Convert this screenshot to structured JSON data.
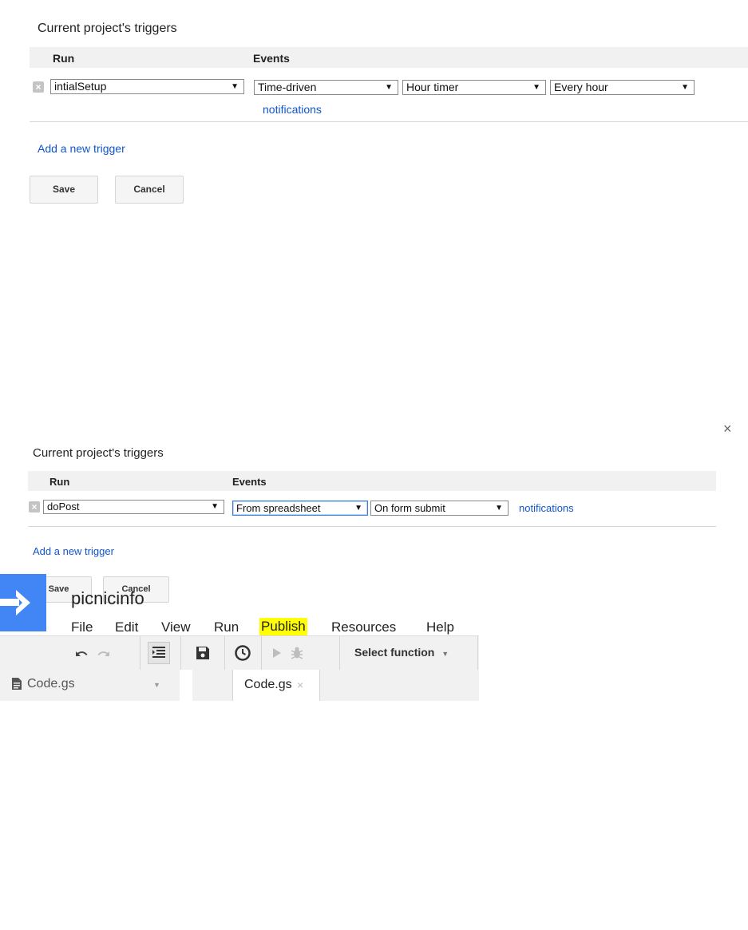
{
  "panel1": {
    "title": "Current project's triggers",
    "col_run": "Run",
    "col_events": "Events",
    "row": {
      "function": "intialSetup",
      "event_source": "Time-driven",
      "event_type": "Hour timer",
      "interval": "Every hour",
      "notifications": "notifications"
    },
    "add_trigger": "Add a new trigger",
    "save": "Save",
    "cancel": "Cancel"
  },
  "panel2": {
    "close": "×",
    "title": "Current project's triggers",
    "col_run": "Run",
    "col_events": "Events",
    "row": {
      "function": "doPost",
      "event_source": "From spreadsheet",
      "event_type": "On form submit",
      "notifications": "notifications"
    },
    "add_trigger": "Add a new trigger",
    "save": "Save",
    "cancel": "Cancel"
  },
  "editor": {
    "project_name": "picnicinfo",
    "menu": [
      "File",
      "Edit",
      "View",
      "Run",
      "Publish",
      "Resources",
      "Help"
    ],
    "highlighted_menu": "Publish",
    "select_function": "Select function",
    "file_label": "Code.gs",
    "tab_label": "Code.gs",
    "tab_close": "×"
  },
  "colors": {
    "highlight": "#ffff00",
    "link": "#1155cc",
    "logo": "#4285f4"
  }
}
